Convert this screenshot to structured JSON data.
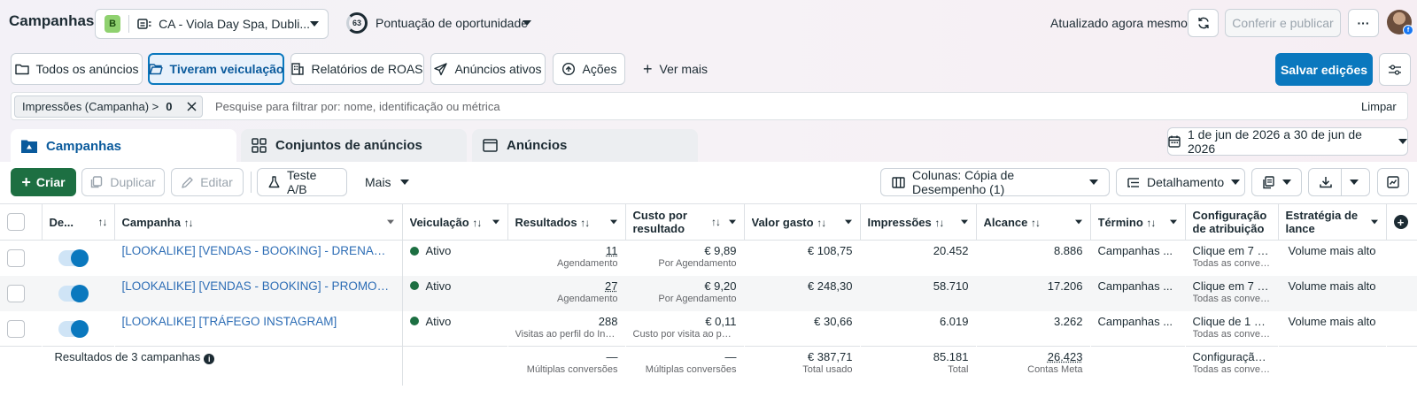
{
  "header": {
    "title": "Campanhas",
    "account": {
      "badge": "B",
      "name": "CA - Viola Day Spa, Dubli..."
    },
    "score": {
      "value": "63",
      "label": "Pontuação de oportunidade"
    },
    "updated": "Atualizado agora mesmo",
    "publish_label": "Conferir e publicar",
    "more_label": "···",
    "avatar_badge": "f"
  },
  "filters": {
    "buttons": [
      "Todos os anúncios",
      "Tiveram veiculação",
      "Relatórios de ROAS",
      "Anúncios ativos",
      "Ações"
    ],
    "see_more": "Ver mais",
    "save_label": "Salvar edições"
  },
  "search": {
    "chip_label": "Impressões (Campanha) >",
    "chip_value": "0",
    "placeholder": "Pesquise para filtrar por: nome, identificação ou métrica",
    "clear": "Limpar"
  },
  "tabs": [
    "Campanhas",
    "Conjuntos de anúncios",
    "Anúncios"
  ],
  "date_range": "1 de jun de 2026 a 30 de jun de 2026",
  "actions": {
    "create": "Criar",
    "duplicate": "Duplicar",
    "edit": "Editar",
    "ab_test": "Teste A/B",
    "more": "Mais",
    "columns": "Colunas: Cópia de Desempenho (1)",
    "breakdown": "Detalhamento"
  },
  "table": {
    "headers": {
      "delivery_toggle": "De...",
      "campaign": "Campanha",
      "delivery": "Veiculação",
      "results": "Resultados",
      "cost_per_result": "Custo por resultado",
      "amount_spent": "Valor gasto",
      "impressions": "Impressões",
      "reach": "Alcance",
      "ends": "Término",
      "attribution": "Configuração de atribuição",
      "bid_strategy": "Estratégia de lance"
    },
    "rows": [
      {
        "name": "[LOOKALIKE] [VENDAS - BOOKING] - DRENAGEM ...",
        "status": "Ativo",
        "results": "11",
        "results_sub": "Agendamento",
        "cost": "€ 9,89",
        "cost_sub": "Por Agendamento",
        "spent": "€ 108,75",
        "impressions": "20.452",
        "reach": "8.886",
        "ends": "Campanhas ...",
        "attribution": "Clique em 7 di...",
        "attribution_sub": "Todas as convers...",
        "bid": "Volume mais alto"
      },
      {
        "name": "[LOOKALIKE] [VENDAS - BOOKING] - PROMOÇÕES",
        "status": "Ativo",
        "results": "27",
        "results_sub": "Agendamento",
        "cost": "€ 9,20",
        "cost_sub": "Por Agendamento",
        "spent": "€ 248,30",
        "impressions": "58.710",
        "reach": "17.206",
        "ends": "Campanhas ...",
        "attribution": "Clique em 7 di...",
        "attribution_sub": "Todas as convers...",
        "bid": "Volume mais alto"
      },
      {
        "name": "[LOOKALIKE] [TRÁFEGO INSTAGRAM]",
        "status": "Ativo",
        "results": "288",
        "results_sub": "Visitas ao perfil do Inst...",
        "cost": "€ 0,11",
        "cost_sub": "Custo por visita ao perf...",
        "spent": "€ 30,66",
        "impressions": "6.019",
        "reach": "3.262",
        "ends": "Campanhas ...",
        "attribution": "Clique de 1 dias",
        "attribution_sub": "Todas as convers...",
        "bid": "Volume mais alto"
      }
    ],
    "totals": {
      "label": "Resultados de 3 campanhas",
      "results": "—",
      "results_sub": "Múltiplas conversões",
      "cost": "—",
      "cost_sub": "Múltiplas conversões",
      "spent": "€ 387,71",
      "spent_sub": "Total usado",
      "impressions": "85.181",
      "impressions_sub": "Total",
      "reach": "26.423",
      "reach_sub": "Contas Meta",
      "attribution": "Configuração...",
      "attribution_sub": "Todas as convers..."
    }
  },
  "colors": {
    "accent": "#0a78be",
    "create": "#1d6f42",
    "active_dot": "#1d6f42",
    "link": "#2d6db5"
  }
}
